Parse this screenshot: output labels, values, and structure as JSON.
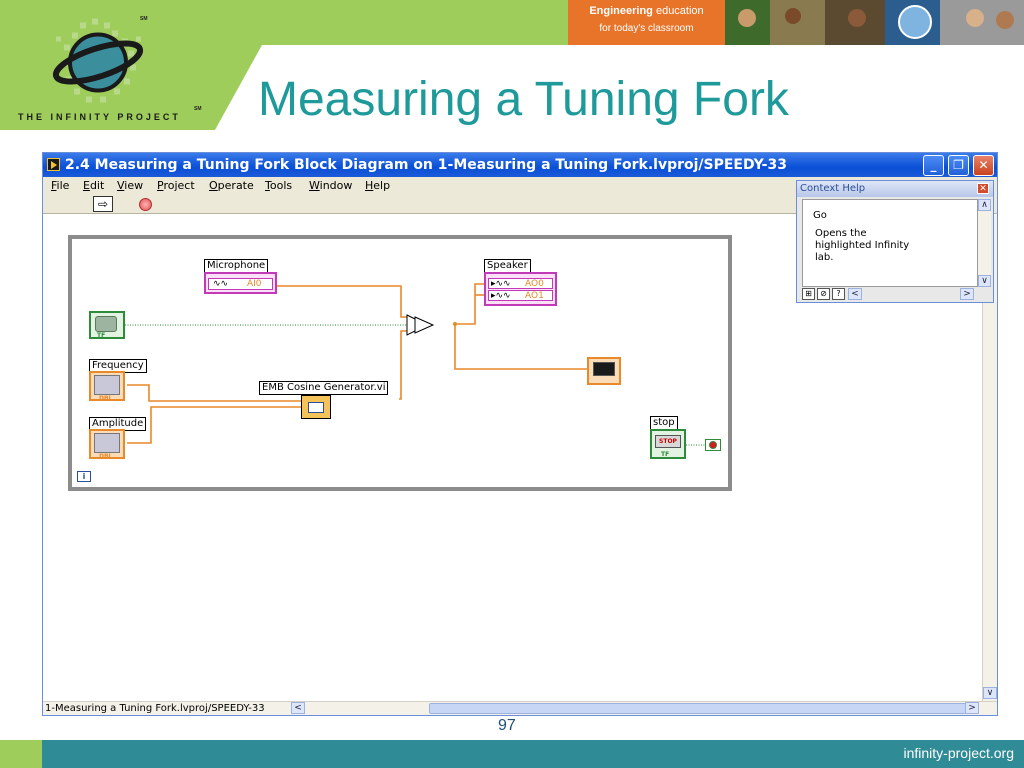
{
  "slide": {
    "title": "Measuring a Tuning Fork",
    "brand_text": "THE INFINITY PROJECT",
    "brand_sm": "SM",
    "header_box_bold": "Engineering",
    "header_box_rest": "education",
    "header_box_line2": "for today's classroom",
    "page_number": "97",
    "footer_url": "infinity-project.org",
    "colors": {
      "green": "#9fcd5c",
      "teal": "#2f8b96",
      "orange": "#e8742a",
      "title": "#1f9a9a"
    }
  },
  "window": {
    "title": "2.4 Measuring a Tuning Fork Block Diagram on 1-Measuring a Tuning Fork.lvproj/SPEEDY-33",
    "menu": [
      {
        "label": "File",
        "key": "F",
        "rest": "ile"
      },
      {
        "label": "Edit",
        "key": "E",
        "rest": "dit"
      },
      {
        "label": "View",
        "key": "V",
        "rest": "iew"
      },
      {
        "label": "Project",
        "key": "P",
        "rest": "roject"
      },
      {
        "label": "Operate",
        "key": "O",
        "rest": "perate"
      },
      {
        "label": "Tools",
        "key": "T",
        "rest": "ools"
      },
      {
        "label": "Window",
        "key": "W",
        "rest": "indow"
      },
      {
        "label": "Help",
        "key": "H",
        "rest": "elp"
      }
    ],
    "status_bar": "1-Measuring a Tuning Fork.lvproj/SPEEDY-33",
    "run_icon": "run-arrow-icon",
    "abort_icon": "abort-icon"
  },
  "diagram": {
    "microphone_label": "Microphone",
    "microphone_channel": "AI0",
    "speaker_label": "Speaker",
    "speaker_channels": [
      "AO0",
      "AO1"
    ],
    "frequency_label": "Frequency",
    "amplitude_label": "Amplitude",
    "cosine_label": "EMB Cosine Generator.vi",
    "stop_label": "stop",
    "stop_button_text": "STOP",
    "bool_text": "TF",
    "dbl_text": "DBL",
    "loop_iteration": "i"
  },
  "context_help": {
    "title": "Context Help",
    "item": "Go",
    "description": "Opens the highlighted Infinity lab."
  }
}
